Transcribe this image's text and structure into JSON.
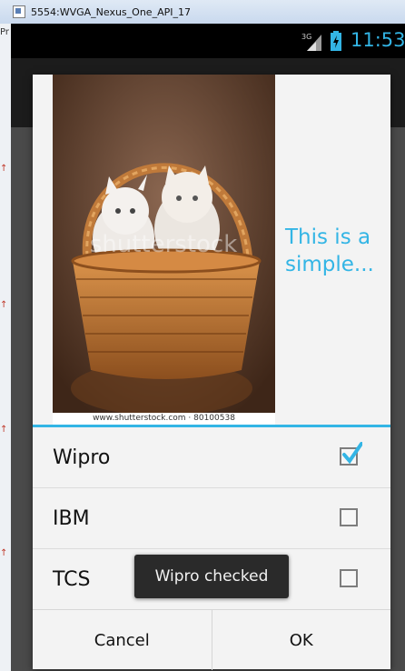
{
  "window": {
    "title": "5554:WVGA_Nexus_One_API_17",
    "host_partial_text": "Pr"
  },
  "statusbar": {
    "network": "3G",
    "time": "11:53"
  },
  "dialog": {
    "title": "This is a simple...",
    "image": {
      "description_icon": "kittens-in-basket-photo",
      "watermark": "shutterstock",
      "caption": "www.shutterstock.com · 80100538"
    },
    "options": [
      {
        "label": "Wipro",
        "checked": true
      },
      {
        "label": "IBM",
        "checked": false
      },
      {
        "label": "TCS",
        "checked": false
      }
    ],
    "buttons": {
      "cancel": "Cancel",
      "ok": "OK"
    }
  },
  "toast": {
    "text": "Wipro checked"
  },
  "colors": {
    "accent": "#33b5e5",
    "statusbar_bg": "#000000",
    "dialog_bg": "#f3f3f3",
    "toast_bg": "#2a2a2a"
  }
}
